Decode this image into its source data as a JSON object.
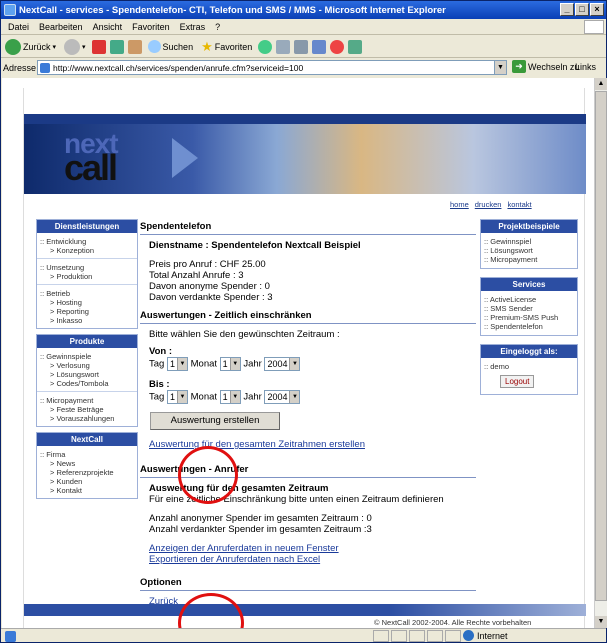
{
  "window": {
    "title": "NextCall - services - Spendentelefon- CTI, Telefon und SMS / MMS - Microsoft Internet Explorer",
    "menu": [
      "Datei",
      "Bearbeiten",
      "Ansicht",
      "Favoriten",
      "Extras",
      "?"
    ],
    "toolbar": {
      "back": "Zurück",
      "search": "Suchen",
      "favorites": "Favoriten"
    },
    "address_label": "Adresse",
    "address_value": "http://www.nextcall.ch/services/spenden/anrufe.cfm?serviceid=100",
    "go_label": "Wechseln zu",
    "links_label": "Links",
    "status_zone": "Internet"
  },
  "header": {
    "logo_top": "next",
    "logo_bottom": "call",
    "toplinks": [
      "home",
      "drucken",
      "kontakt"
    ]
  },
  "leftnav": {
    "dienstleistungen_title": "Dienstleistungen",
    "dienstleistungen": [
      {
        "label": ":: Entwicklung",
        "sub": [
          "> Konzeption"
        ]
      },
      {
        "label": ":: Umsetzung",
        "sub": [
          "> Produktion"
        ]
      },
      {
        "label": ":: Betrieb",
        "sub": [
          "> Hosting",
          "> Reporting",
          "> Inkasso"
        ]
      }
    ],
    "produkte_title": "Produkte",
    "produkte": [
      {
        "label": ":: Gewinnspiele",
        "sub": [
          "> Verlosung",
          "> Lösungswort",
          "> Codes/Tombola"
        ]
      },
      {
        "label": ":: Micropayment",
        "sub": [
          "> Feste Beträge",
          "> Vorauszahlungen"
        ]
      }
    ],
    "nextcall_title": "NextCall",
    "nextcall": [
      {
        "label": ":: Firma",
        "sub": [
          "> News",
          "> Referenzprojekte",
          "> Kunden",
          "> Kontakt"
        ]
      }
    ]
  },
  "main": {
    "section1_title": "Spendentelefon",
    "dienstname": "Dienstname : Spendentelefon Nextcall Beispiel",
    "preis": "Preis pro Anruf : CHF 25.00",
    "total": "Total Anzahl Anrufe : 3",
    "anonym": "Davon anonyme Spender : 0",
    "verdankt": "Davon verdankte Spender : 3",
    "section2_title": "Auswertungen - Zeitlich einschränken",
    "instr": "Bitte wählen Sie den gewünschten Zeitraum :",
    "von_label": "Von :",
    "bis_label": "Bis :",
    "tag_label": "Tag",
    "monat_label": "Monat",
    "jahr_label": "Jahr",
    "von_tag": "1",
    "von_monat": "1",
    "von_jahr": "2004",
    "bis_tag": "1",
    "bis_monat": "1",
    "bis_jahr": "2004",
    "button_label": "Auswertung erstellen",
    "link_gesamt": "Auswertung für den gesamten Zeitrahmen erstellen",
    "section3_title": "Auswertungen - Anrufer",
    "gesamt_head": "Auswertung für den gesamten Zeitraum",
    "gesamt_hint": "Für eine zeitliche Einschränkung bitte unten einen Zeitraum definieren",
    "anonym_gesamt": "Anzahl anonymer Spender im gesamten Zeitraum : 0",
    "verdankt_gesamt": "Anzahl verdankter Spender im gesamten Zeitraum :3",
    "link_anzeigen": "Anzeigen der Anruferdaten in neuem Fenster",
    "link_export": "Exportieren der Anruferdaten nach Excel",
    "section4_title": "Optionen",
    "link_zurueck": "Zurück"
  },
  "rightnav": {
    "projekt_title": "Projektbeispiele",
    "projekt": [
      ":: Gewinnspiel",
      ":: Lösungswort",
      ":: Micropayment"
    ],
    "services_title": "Services",
    "services": [
      ":: ActiveLicense",
      ":: SMS Sender",
      ":: Premium-SMS Push",
      ":: Spendentelefon"
    ],
    "login_title": "Eingeloggt als:",
    "login_user": ":: demo",
    "logout_label": "Logout"
  },
  "footer": {
    "copyright": "© NextCall  2002-2004. Alle Rechte vorbehalten"
  },
  "colors": {
    "nav_blue": "#2c4ea3",
    "annotation_red": "#e01010"
  }
}
